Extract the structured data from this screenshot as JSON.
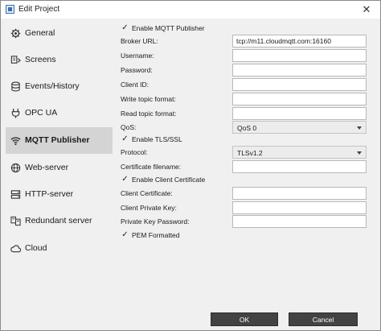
{
  "window": {
    "title": "Edit Project",
    "close_glyph": "✕"
  },
  "sidebar": {
    "items": [
      {
        "label": "General",
        "icon": "gear-icon",
        "active": false
      },
      {
        "label": "Screens",
        "icon": "screens-icon",
        "active": false
      },
      {
        "label": "Events/History",
        "icon": "database-icon",
        "active": false
      },
      {
        "label": "OPC UA",
        "icon": "plug-icon",
        "active": false
      },
      {
        "label": "MQTT Publisher",
        "icon": "wifi-icon",
        "active": true
      },
      {
        "label": "Web-server",
        "icon": "globe-icon",
        "active": false
      },
      {
        "label": "HTTP-server",
        "icon": "server-icon",
        "active": false
      },
      {
        "label": "Redundant server",
        "icon": "redundant-server-icon",
        "active": false
      },
      {
        "label": "Cloud",
        "icon": "cloud-icon",
        "active": false
      }
    ]
  },
  "form": {
    "enable_mqtt": {
      "label": "Enable MQTT Publisher",
      "checked": true
    },
    "broker_url": {
      "label": "Broker URL:",
      "value": "tcp://m11.cloudmqtt.com:16160"
    },
    "username": {
      "label": "Username:",
      "value": ""
    },
    "password": {
      "label": "Password:",
      "value": ""
    },
    "client_id": {
      "label": "Client ID:",
      "value": ""
    },
    "write_topic": {
      "label": "Write topic format:",
      "value": ""
    },
    "read_topic": {
      "label": "Read topic format:",
      "value": ""
    },
    "qos": {
      "label": "QoS:",
      "value": "QoS 0"
    },
    "enable_tls": {
      "label": "Enable TLS/SSL",
      "checked": true
    },
    "protocol": {
      "label": "Protocol:",
      "value": "TLSv1.2"
    },
    "cert_filename": {
      "label": "Certificate filename:",
      "value": ""
    },
    "enable_client_cert": {
      "label": "Enable Client Certificate",
      "checked": true
    },
    "client_cert": {
      "label": "Client Certificate:",
      "value": ""
    },
    "client_private_key": {
      "label": "Client Private Key:",
      "value": ""
    },
    "private_key_password": {
      "label": "Private Key Password:",
      "value": ""
    },
    "pem_formatted": {
      "label": "PEM Formatted",
      "checked": true
    },
    "check_glyph": "✓"
  },
  "buttons": {
    "ok_label": "OK",
    "cancel_label": "Cancel"
  }
}
